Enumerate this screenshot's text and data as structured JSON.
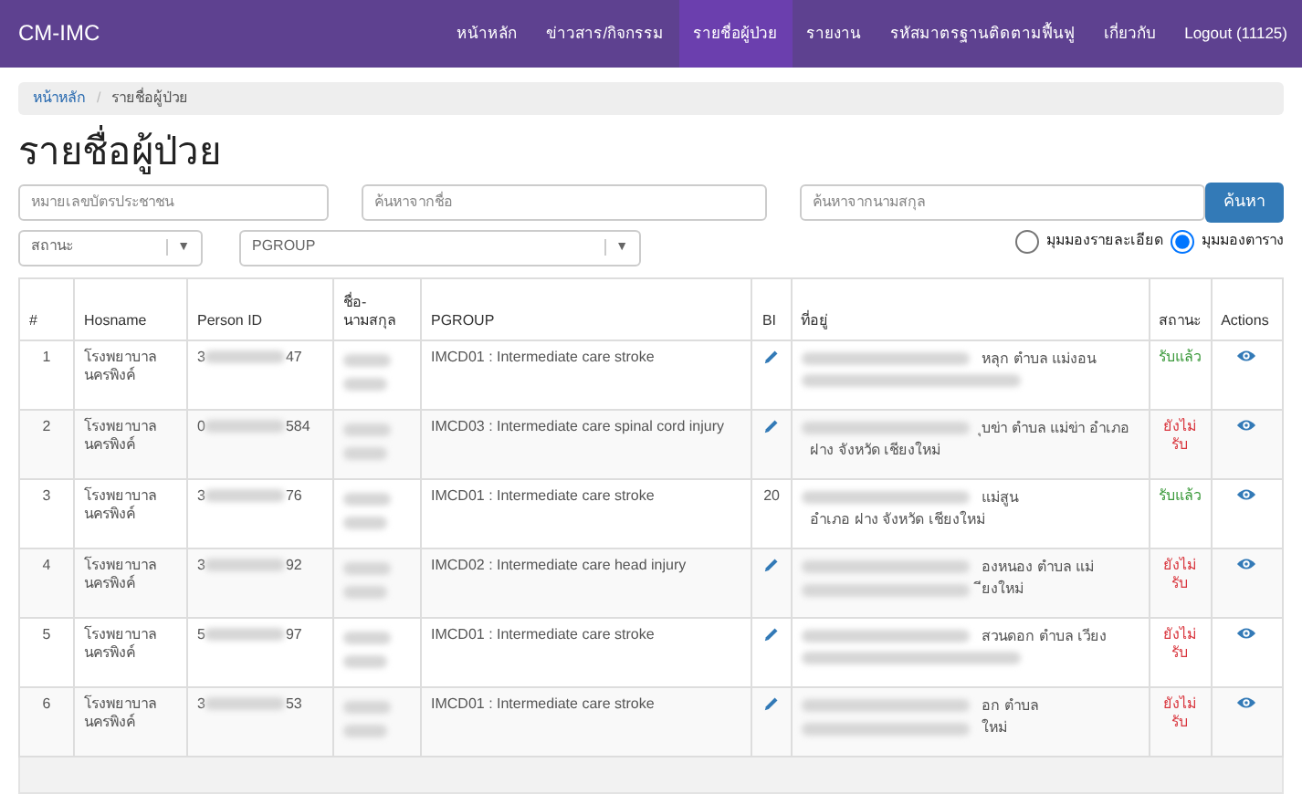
{
  "navbar": {
    "brand": "CM-IMC",
    "items": [
      {
        "label": "หน้าหลัก",
        "selected": false
      },
      {
        "label": "ข่าวสาร/กิจกรรม",
        "selected": false
      },
      {
        "label": "รายชื่อผู้ป่วย",
        "selected": true
      },
      {
        "label": "รายงาน",
        "selected": false
      },
      {
        "label": "รหัสมาตรฐานติดตามฟื้นฟู",
        "selected": false
      },
      {
        "label": "เกี่ยวกับ",
        "selected": false
      },
      {
        "label": "Logout (11125)",
        "selected": false
      }
    ]
  },
  "breadcrumb": {
    "separator": "/",
    "items": [
      {
        "label": "หน้าหลัก",
        "kind": "link"
      },
      {
        "label": "รายชื่อผู้ป่วย",
        "kind": "current"
      }
    ]
  },
  "heading": "รายชื่อผู้ป่วย",
  "filters": {
    "id_field": {
      "placeholder": "หมายเลขบัตรประชาชน"
    },
    "name_field": {
      "placeholder": "ค้นหาจากชื่อ"
    },
    "surname_field": {
      "placeholder": "ค้นหาจากนามสกุล"
    },
    "search_button": "ค้นหา",
    "status_select": {
      "value": "สถานะ",
      "caret": "▼"
    },
    "pgroup_select": {
      "value": "PGROUP",
      "caret": "▼"
    },
    "views": [
      {
        "label": "มุมมองรายละเอียด",
        "selected": false
      },
      {
        "label": "มุมมองตาราง",
        "selected": true
      }
    ]
  },
  "table": {
    "columns": [
      "#",
      "Hosname",
      "Person ID",
      "ชื่อ-นามสกุล",
      "PGROUP",
      "BI",
      "ที่อยู่",
      "สถานะ",
      "Actions"
    ],
    "rows": [
      {
        "no": "1",
        "hosname": "โรงพยาบาลนครพิงค์",
        "id_start": "3",
        "id_end": "47",
        "pgroup": "IMCD01 : Intermediate care stroke",
        "bi": {
          "kind": "edit"
        },
        "address": [
          {
            "text": "หลุก ตำบล แม่งอน",
            "redacted": true
          },
          {
            "redacted": true
          }
        ],
        "status": "รับแล้ว",
        "accepted": true
      },
      {
        "no": "2",
        "hosname": "โรงพยาบาลนครพิงค์",
        "id_start": "0",
        "id_end": "584",
        "pgroup": "IMCD03 : Intermediate care spinal cord injury",
        "bi": {
          "kind": "edit"
        },
        "address": [
          {
            "text": "ุบข่า ตำบล แม่ข่า อำเภอ",
            "redacted": true
          },
          {
            "text": "ฝาง จังหวัด เชียงใหม่",
            "redacted": false
          }
        ],
        "status": "ยังไม่รับ",
        "accepted": false
      },
      {
        "no": "3",
        "hosname": "โรงพยาบาลนครพิงค์",
        "id_start": "3",
        "id_end": "76",
        "pgroup": "IMCD01 : Intermediate care stroke",
        "bi": {
          "kind": "score",
          "value": "20"
        },
        "address": [
          {
            "text": "แม่สูน",
            "redacted": true
          },
          {
            "text": "อำเภอ ฝาง จังหวัด เชียงใหม่",
            "redacted": false
          }
        ],
        "status": "รับแล้ว",
        "accepted": true
      },
      {
        "no": "4",
        "hosname": "โรงพยาบาลนครพิงค์",
        "id_start": "3",
        "id_end": "92",
        "pgroup": "IMCD02 : Intermediate care head injury",
        "bi": {
          "kind": "edit"
        },
        "address": [
          {
            "text": "องหนอง ตำบล แม่",
            "redacted": true
          },
          {
            "text": "ียงใหม่",
            "redacted": true
          }
        ],
        "status": "ยังไม่รับ",
        "accepted": false
      },
      {
        "no": "5",
        "hosname": "โรงพยาบาลนครพิงค์",
        "id_start": "5",
        "id_end": "97",
        "pgroup": "IMCD01 : Intermediate care stroke",
        "bi": {
          "kind": "edit"
        },
        "address": [
          {
            "text": "สวนดอก ตำบล เวียง",
            "redacted": true
          },
          {
            "redacted": true
          }
        ],
        "status": "ยังไม่รับ",
        "accepted": false
      },
      {
        "no": "6",
        "hosname": "โรงพยาบาลนครพิงค์",
        "id_start": "3",
        "id_end": "53",
        "pgroup": "IMCD01 : Intermediate care stroke",
        "bi": {
          "kind": "edit"
        },
        "address": [
          {
            "text": "อก ตำบล",
            "redacted": true
          },
          {
            "text": "ใหม่",
            "redacted": true
          }
        ],
        "status": "ยังไม่รับ",
        "accepted": false
      }
    ]
  }
}
